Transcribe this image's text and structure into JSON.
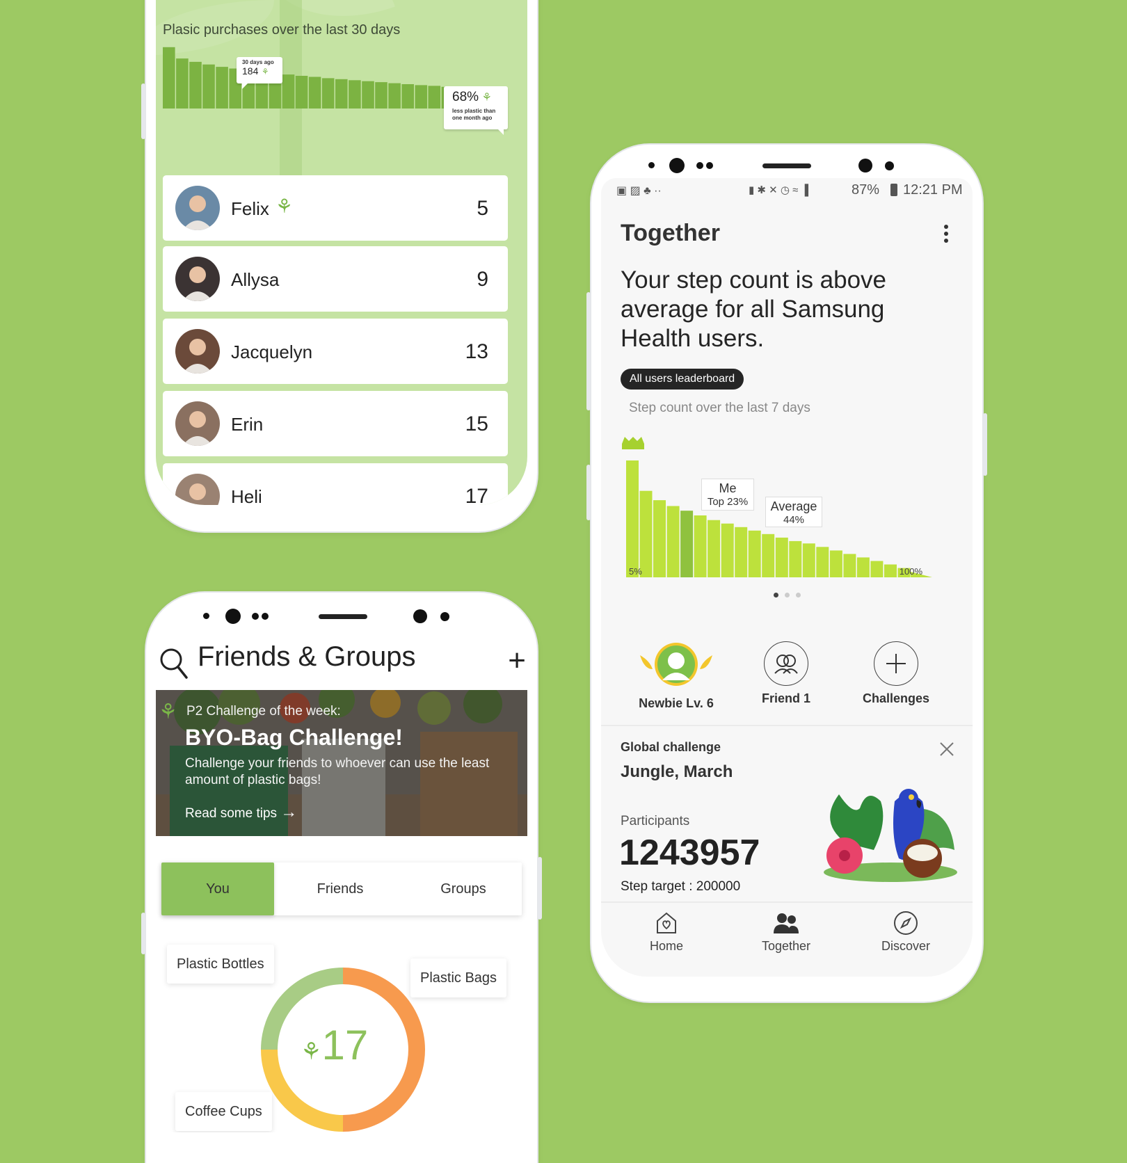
{
  "plastic_phone": {
    "chart_title": "Plasic purchases over the last 30 days",
    "chart_data": {
      "type": "area",
      "title": "Plasic purchases over the last 30 days",
      "values": [
        184,
        150,
        140,
        132,
        125,
        120,
        114,
        110,
        106,
        102,
        98,
        95,
        91,
        88,
        85,
        82,
        79,
        76,
        73,
        70,
        68,
        65,
        62,
        60,
        58,
        59
      ]
    },
    "tip_start_label": "30 days ago",
    "tip_start_value": "184",
    "tip_end_value": "68%",
    "tip_end_text": "less plastic than one month ago",
    "leaderboard": [
      {
        "name": "Felix",
        "score": "5",
        "sprout": true,
        "avatar_color": "#6a8aa6"
      },
      {
        "name": "Allysa",
        "score": "9",
        "sprout": false,
        "avatar_color": "#3b3333"
      },
      {
        "name": "Jacquelyn",
        "score": "13",
        "sprout": false,
        "avatar_color": "#6b4a3a"
      },
      {
        "name": "Erin",
        "score": "15",
        "sprout": false,
        "avatar_color": "#8a7060"
      },
      {
        "name": "Heli",
        "score": "17",
        "sprout": false,
        "avatar_color": "#9a8272"
      }
    ]
  },
  "friends_phone": {
    "title": "Friends & Groups",
    "banner_subtitle": "P2 Challenge of the week:",
    "banner_title": "BYO-Bag Challenge!",
    "banner_description": "Challenge your friends to whoever can use the least amount of plastic bags!",
    "banner_link": "Read some tips",
    "tabs": [
      "You",
      "Friends",
      "Groups"
    ],
    "active_tab": "You",
    "donut_total": "17",
    "donut_segments": [
      {
        "label": "Plastic Bags",
        "fraction": 0.5,
        "color": "#f79a4e"
      },
      {
        "label": "Coffee Cups",
        "fraction": 0.25,
        "color": "#f9c84a"
      },
      {
        "label": "Plastic Bottles",
        "fraction": 0.25,
        "color": "#a8cc85"
      }
    ]
  },
  "health_phone": {
    "status": {
      "battery": "87%",
      "time": "12:21 PM"
    },
    "title": "Together",
    "headline": "Your step count is above average for all Samsung Health users.",
    "pill": "All users leaderboard",
    "chart_subtitle": "Step count over the last 7 days",
    "chart_data": {
      "type": "area",
      "title": "Step count over the last 7 days",
      "x_start_label": "5%",
      "x_end_label": "100%",
      "values": [
        100,
        74,
        66,
        61,
        57,
        53,
        49,
        46,
        43,
        40,
        37,
        34,
        31,
        29,
        26,
        23,
        20,
        17,
        14,
        11,
        8
      ],
      "highlight_index": 4
    },
    "me_label": "Me",
    "me_value": "Top 23%",
    "avg_label": "Average",
    "avg_value": "44%",
    "stats": [
      {
        "label": "Newbie Lv. 6",
        "icon": "avatar-badge-icon"
      },
      {
        "label": "Friend 1",
        "icon": "friends-icon"
      },
      {
        "label": "Challenges",
        "icon": "plus-icon"
      }
    ],
    "global_challenge_label": "Global challenge",
    "global_challenge_title": "Jungle, March",
    "participants_label": "Participants",
    "participants_value": "1243957",
    "step_target": "Step target : 200000",
    "nav": [
      {
        "label": "Home",
        "icon": "home-icon"
      },
      {
        "label": "Together",
        "icon": "together-icon"
      },
      {
        "label": "Discover",
        "icon": "discover-icon"
      }
    ],
    "accent": "#bde13c"
  }
}
